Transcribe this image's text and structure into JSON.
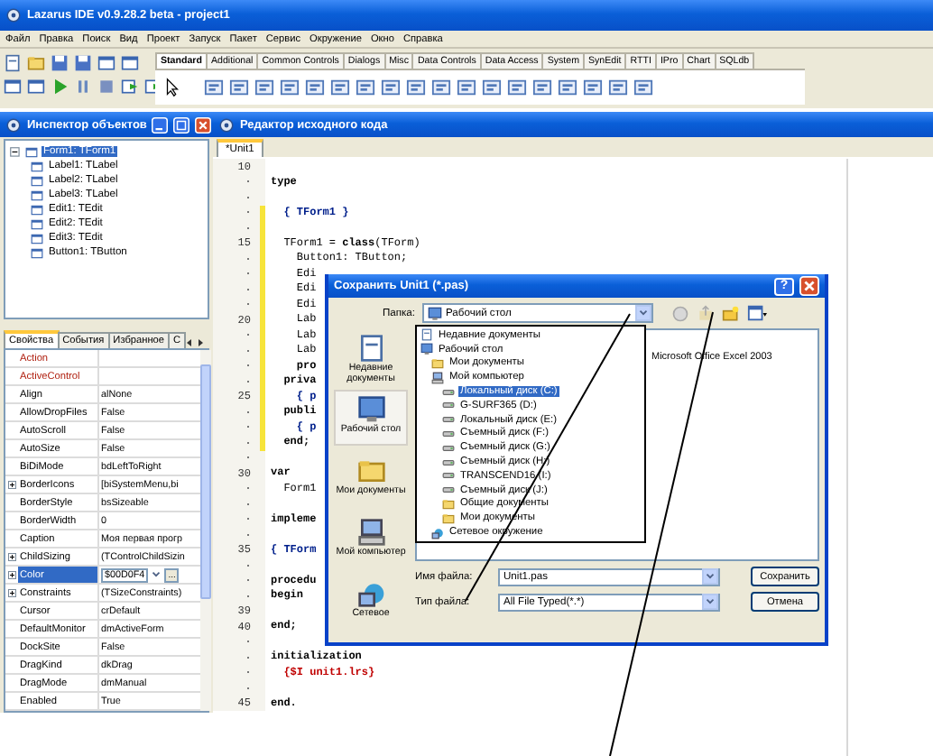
{
  "ide": {
    "title": "Lazarus IDE v0.9.28.2 beta - project1",
    "menu": [
      "Файл",
      "Правка",
      "Поиск",
      "Вид",
      "Проект",
      "Запуск",
      "Пакет",
      "Сервис",
      "Окружение",
      "Окно",
      "Справка"
    ],
    "palette_tabs": [
      {
        "label": "Standard",
        "selected": true
      },
      {
        "label": "Additional",
        "selected": false
      },
      {
        "label": "Common Controls",
        "selected": false
      },
      {
        "label": "Dialogs",
        "selected": false
      },
      {
        "label": "Misc",
        "selected": false
      },
      {
        "label": "Data Controls",
        "selected": false
      },
      {
        "label": "Data Access",
        "selected": false
      },
      {
        "label": "System",
        "selected": false
      },
      {
        "label": "SynEdit",
        "selected": false
      },
      {
        "label": "RTTI",
        "selected": false
      },
      {
        "label": "IPro",
        "selected": false
      },
      {
        "label": "Chart",
        "selected": false
      },
      {
        "label": "SQLdb",
        "selected": false
      }
    ]
  },
  "inspector": {
    "title": "Инспектор объектов",
    "tree": [
      {
        "label": "Form1: TForm1",
        "selected": true,
        "expanded": true,
        "children": [
          {
            "label": "Label1: TLabel",
            "selected": false
          },
          {
            "label": "Label2: TLabel",
            "selected": false
          },
          {
            "label": "Label3: TLabel",
            "selected": false
          },
          {
            "label": "Edit1: TEdit",
            "selected": false
          },
          {
            "label": "Edit2: TEdit",
            "selected": false
          },
          {
            "label": "Edit3: TEdit",
            "selected": false
          },
          {
            "label": "Button1: TButton",
            "selected": false
          }
        ]
      }
    ],
    "tabs": [
      {
        "label": "Свойства",
        "selected": true
      },
      {
        "label": "События",
        "selected": false
      },
      {
        "label": "Избранное",
        "selected": false
      },
      {
        "label": "С",
        "selected": false
      }
    ],
    "properties": [
      {
        "name": "Action",
        "kind": "reference",
        "expandable": false,
        "selected": false
      },
      {
        "name": "ActiveControl",
        "kind": "reference",
        "expandable": false,
        "selected": false
      },
      {
        "name": "Align",
        "value": "alNone",
        "kind": "plain",
        "expandable": false,
        "selected": false
      },
      {
        "name": "AllowDropFiles",
        "value": "False",
        "kind": "plain",
        "expandable": false,
        "selected": false
      },
      {
        "name": "AutoScroll",
        "value": "False",
        "kind": "plain",
        "expandable": false,
        "selected": false
      },
      {
        "name": "AutoSize",
        "value": "False",
        "kind": "plain",
        "expandable": false,
        "selected": false
      },
      {
        "name": "BiDiMode",
        "value": "bdLeftToRight",
        "kind": "plain",
        "expandable": false,
        "selected": false
      },
      {
        "name": "BorderIcons",
        "value": "[biSystemMenu,bi",
        "kind": "plain",
        "expandable": true,
        "selected": false
      },
      {
        "name": "BorderStyle",
        "value": "bsSizeable",
        "kind": "plain",
        "expandable": false,
        "selected": false
      },
      {
        "name": "BorderWidth",
        "value": "0",
        "kind": "plain",
        "expandable": false,
        "selected": false
      },
      {
        "name": "Caption",
        "value": "Моя первая прогр",
        "kind": "plain",
        "expandable": false,
        "selected": false
      },
      {
        "name": "ChildSizing",
        "value": "(TControlChildSizin",
        "kind": "plain",
        "expandable": true,
        "selected": false
      },
      {
        "name": "Color",
        "value": "$00D0F4",
        "button": "...",
        "kind": "plain",
        "expandable": true,
        "selected": true
      },
      {
        "name": "Constraints",
        "value": "(TSizeConstraints)",
        "kind": "plain",
        "expandable": true,
        "selected": false
      },
      {
        "name": "Cursor",
        "value": "crDefault",
        "kind": "plain",
        "expandable": false,
        "selected": false
      },
      {
        "name": "DefaultMonitor",
        "value": "dmActiveForm",
        "kind": "plain",
        "expandable": false,
        "selected": false
      },
      {
        "name": "DockSite",
        "value": "False",
        "kind": "plain",
        "expandable": false,
        "selected": false
      },
      {
        "name": "DragKind",
        "value": "dkDrag",
        "kind": "plain",
        "expandable": false,
        "selected": false
      },
      {
        "name": "DragMode",
        "value": "dmManual",
        "kind": "plain",
        "expandable": false,
        "selected": false
      },
      {
        "name": "Enabled",
        "value": "True",
        "kind": "plain",
        "expandable": false,
        "selected": false
      }
    ]
  },
  "editor": {
    "title": "Редактор исходного кода",
    "tabs": [
      {
        "label": "*Unit1",
        "selected": true
      }
    ],
    "lines": [
      {
        "n": "10",
        "kind": "blank",
        "modified": false
      },
      {
        "text": "type",
        "kind": "keyword",
        "modified": false
      },
      {
        "kind": "blank",
        "modified": false
      },
      {
        "text": "  { TForm1 }",
        "kind": "comment",
        "modified": true
      },
      {
        "kind": "blank",
        "modified": true
      },
      {
        "n": "15",
        "text": "  TForm1 = **class**(TForm)",
        "kind": "code",
        "modified": true
      },
      {
        "text": "    Button1: TButton;",
        "kind": "code",
        "modified": true
      },
      {
        "text": "    Edi",
        "kind": "code",
        "modified": true
      },
      {
        "text": "    Edi",
        "kind": "code",
        "modified": true
      },
      {
        "text": "    Edi",
        "kind": "code",
        "modified": true
      },
      {
        "n": "20",
        "text": "    Lab",
        "kind": "code",
        "modified": true
      },
      {
        "text": "    Lab",
        "kind": "code",
        "modified": true
      },
      {
        "text": "    Lab",
        "kind": "code",
        "modified": true
      },
      {
        "text": "    pro",
        "kind": "keyword",
        "modified": true
      },
      {
        "text": "  priva",
        "kind": "keyword",
        "modified": true
      },
      {
        "n": "25",
        "text": "    { p",
        "kind": "comment",
        "modified": true
      },
      {
        "text": "  publi",
        "kind": "keyword",
        "modified": true
      },
      {
        "text": "    { p",
        "kind": "comment",
        "modified": true
      },
      {
        "text": "  end;",
        "kind": "keyword",
        "modified": true
      },
      {
        "kind": "blank",
        "modified": false
      },
      {
        "n": "30",
        "text": "var",
        "kind": "keyword",
        "modified": false
      },
      {
        "text": "  Form1",
        "kind": "code",
        "modified": false
      },
      {
        "kind": "blank",
        "modified": false
      },
      {
        "text": "impleme",
        "kind": "keyword",
        "modified": false
      },
      {
        "kind": "blank",
        "modified": false
      },
      {
        "n": "35",
        "text": "{ TForm",
        "kind": "comment",
        "modified": false
      },
      {
        "kind": "blank",
        "modified": false
      },
      {
        "text": "procedu",
        "kind": "keyword",
        "modified": false
      },
      {
        "text": "begin",
        "kind": "keyword",
        "modified": false
      },
      {
        "n": "39",
        "kind": "blank",
        "modified": false
      },
      {
        "n": "40",
        "text": "end;",
        "kind": "keyword",
        "modified": false
      },
      {
        "kind": "blank",
        "modified": false
      },
      {
        "text": "initialization",
        "kind": "keyword",
        "modified": false
      },
      {
        "text": "  {$I unit1.lrs}",
        "kind": "directive",
        "modified": false
      },
      {
        "kind": "blank",
        "modified": false
      },
      {
        "n": "45",
        "text": "end.",
        "kind": "keyword",
        "modified": false
      }
    ]
  },
  "dialog": {
    "title": "Сохранить Unit1 (*.pas)",
    "help_button": "?",
    "folder_label": "Папка:",
    "folder": "Рабочий стол",
    "places": [
      {
        "label": "Недавние документы",
        "kind": "recent",
        "selected": false
      },
      {
        "label": "Рабочий стол",
        "kind": "desktop",
        "selected": true
      },
      {
        "label": "Мои документы",
        "kind": "documents",
        "selected": false
      },
      {
        "label": "Мой компьютер",
        "kind": "computer",
        "selected": false
      },
      {
        "label": "Сетевое",
        "kind": "network",
        "selected": false
      }
    ],
    "dropdown": [
      {
        "label": "Недавние документы",
        "kind": "recent",
        "selected": false
      },
      {
        "label": "Рабочий стол",
        "kind": "desktop",
        "selected": false,
        "children": [
          {
            "label": "Мои документы",
            "kind": "folder",
            "selected": false
          },
          {
            "label": "Мой компьютер",
            "kind": "computer",
            "selected": false,
            "children": [
              {
                "label": "Локальный диск (C:)",
                "kind": "drive",
                "selected": true
              },
              {
                "label": "G-SURF365 (D:)",
                "kind": "cdrom",
                "selected": false
              },
              {
                "label": "Локальный диск (E:)",
                "kind": "drive",
                "selected": false
              },
              {
                "label": "Съемный диск (F:)",
                "kind": "drive",
                "selected": false
              },
              {
                "label": "Съемный диск (G:)",
                "kind": "drive",
                "selected": false
              },
              {
                "label": "Съемный диск (H:)",
                "kind": "drive",
                "selected": false
              },
              {
                "label": "TRANSCEND16 (I:)",
                "kind": "drive",
                "selected": false
              },
              {
                "label": "Съемный диск (J:)",
                "kind": "drive",
                "selected": false
              },
              {
                "label": "Общие документы",
                "kind": "folder",
                "selected": false
              },
              {
                "label": "Мои документы",
                "kind": "folder",
                "selected": false
              }
            ]
          },
          {
            "label": "Сетевое окружение",
            "kind": "network",
            "selected": false
          }
        ]
      }
    ],
    "files": [
      "Microsoft Office Excel 2003"
    ],
    "fields": [
      {
        "label": "Имя файла:",
        "value": "Unit1.pas"
      },
      {
        "label": "Тип файла:",
        "value": "All File Typed(*.*)"
      }
    ],
    "buttons": [
      "Сохранить",
      "Отмена"
    ]
  }
}
